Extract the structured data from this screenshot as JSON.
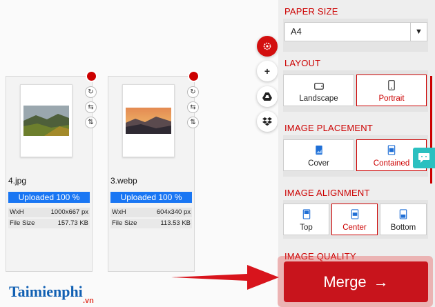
{
  "files": [
    {
      "name": "4.jpg",
      "progress": "Uploaded 100 %",
      "wxh_label": "WxH",
      "wxh": "1000x667 px",
      "size_label": "File Size",
      "size": "157.73 KB"
    },
    {
      "name": "3.webp",
      "progress": "Uploaded 100 %",
      "wxh_label": "WxH",
      "wxh": "604x340 px",
      "size_label": "File Size",
      "size": "113.53 KB"
    }
  ],
  "side_buttons": {
    "plus": "+"
  },
  "panel": {
    "paper_size": {
      "title": "PAPER SIZE",
      "value": "A4",
      "arrow": "▼"
    },
    "layout": {
      "title": "LAYOUT",
      "options": [
        "Landscape",
        "Portrait"
      ],
      "selected": "Portrait"
    },
    "placement": {
      "title": "IMAGE PLACEMENT",
      "options": [
        "Cover",
        "Contained"
      ],
      "selected": "Contained"
    },
    "alignment": {
      "title": "IMAGE ALIGNMENT",
      "options": [
        "Top",
        "Center",
        "Bottom"
      ],
      "selected": "Center"
    },
    "quality": {
      "title": "IMAGE QUALITY"
    }
  },
  "merge": {
    "label": "Merge",
    "arrow": "→"
  },
  "logo": {
    "text": "Taimienphi",
    "suffix": ".vn"
  },
  "colors": {
    "accent": "#c8141c",
    "progress": "#1976f3",
    "chat": "#2bc0c0"
  }
}
